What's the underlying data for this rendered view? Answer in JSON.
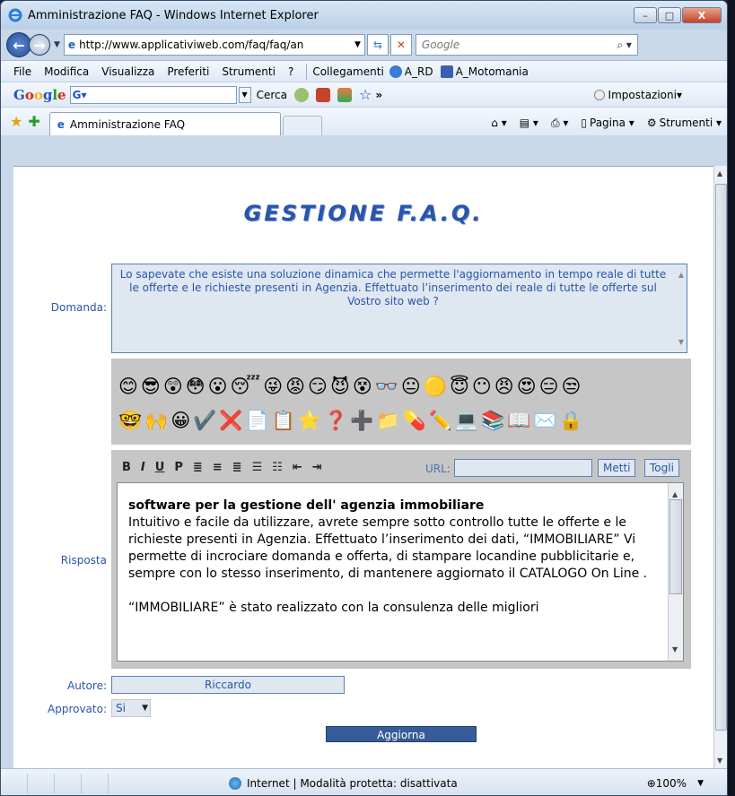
{
  "window": {
    "title": "Amministrazione FAQ - Windows Internet Explorer",
    "minimize": "–",
    "maximize": "□",
    "close": "X"
  },
  "address": {
    "url": "http://www.applicativiweb.com/faq/faq/an",
    "search_placeholder": "Google"
  },
  "menu": {
    "items": [
      "File",
      "Modifica",
      "Visualizza",
      "Preferiti",
      "Strumenti",
      "?"
    ],
    "links_label": "Collegamenti",
    "links": [
      "A_RD",
      "A_Motomania"
    ]
  },
  "google_bar": {
    "search_label": "Cerca",
    "settings_label": "Impostazioni"
  },
  "tabs": {
    "active_tab": "Amministrazione FAQ",
    "commands": [
      "Pagina",
      "Strumenti"
    ]
  },
  "page": {
    "title": "GESTIONE F.A.Q.",
    "domanda_label": "Domanda:",
    "domanda_text": "Lo sapevate che esiste una soluzione dinamica che permette l'aggiornamento in tempo reale di tutte le offerte e le richieste presenti in Agenzia. Effettuato l’inserimento dei reale di tutte le offerte sul Vostro sito web ?",
    "risposta_label": "Risposta",
    "url_label": "URL:",
    "metti_button": "Metti",
    "togli_button": "Togli",
    "editor_title": "software per la gestione dell' agenzia immobiliare",
    "editor_paragraph1": "Intuitivo e facile da utilizzare, avrete sempre sotto controllo tutte le offerte e le richieste presenti in Agenzia. Effettuato l’inserimento dei dati, “IMMOBILIARE” Vi permette di incrociare domanda e offerta, di stampare locandine pubblicitarie e, sempre con lo stesso inserimento, di mantenere aggiornato il CATALOGO On Line .",
    "editor_paragraph2": "“IMMOBILIARE” è stato realizzato con la consulenza delle migliori",
    "autore_label": "Autore:",
    "autore_value": "Riccardo",
    "approvato_label": "Approvato:",
    "approvato_value": "Si",
    "aggiorna_button": "Aggiorna"
  },
  "status": {
    "zone_text": "Internet | Modalità protetta: disattivata",
    "zoom": "100%"
  }
}
